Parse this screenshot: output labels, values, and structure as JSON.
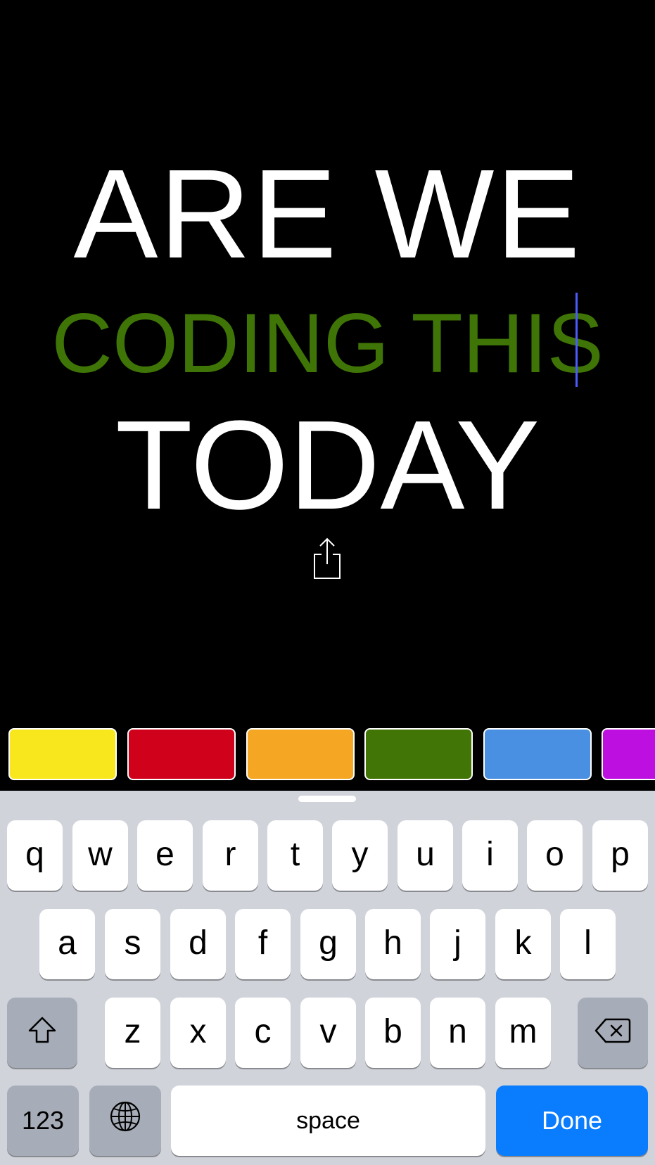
{
  "canvas": {
    "lines": [
      {
        "text": "ARE WE",
        "color": "#ffffff"
      },
      {
        "text": "CODING THIS",
        "color": "#3f7406"
      },
      {
        "text": "TODAY",
        "color": "#ffffff"
      }
    ],
    "share_icon": "share-icon",
    "cursor_color": "#4a5bff"
  },
  "palette": {
    "colors": [
      "#f8e71c",
      "#d0021b",
      "#f5a623",
      "#417505",
      "#4a90e2",
      "#bd10e0"
    ]
  },
  "keyboard": {
    "row1": [
      "q",
      "w",
      "e",
      "r",
      "t",
      "y",
      "u",
      "i",
      "o",
      "p"
    ],
    "row2": [
      "a",
      "s",
      "d",
      "f",
      "g",
      "h",
      "j",
      "k",
      "l"
    ],
    "row3": [
      "z",
      "x",
      "c",
      "v",
      "b",
      "n",
      "m"
    ],
    "shift_icon": "shift-icon",
    "delete_icon": "backspace-icon",
    "numbers_label": "123",
    "globe_icon": "globe-icon",
    "space_label": "space",
    "done_label": "Done",
    "done_color": "#0a7cfe"
  }
}
